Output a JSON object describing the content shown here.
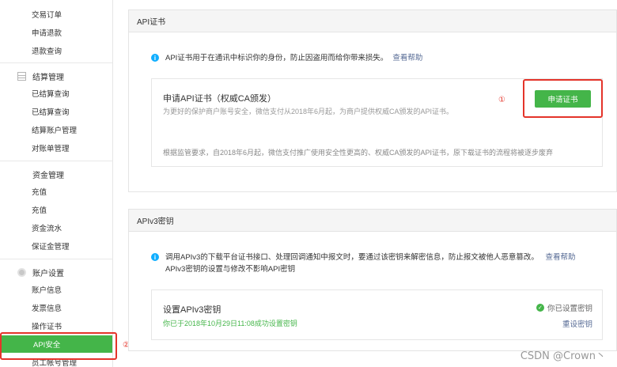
{
  "sidebar": {
    "trade_items": [
      "交易订单",
      "申请退款",
      "退款查询"
    ],
    "settlement": {
      "title": "结算管理",
      "items": [
        "已结算查询",
        "已结算查询",
        "结算账户管理",
        "对账单管理"
      ]
    },
    "funds": {
      "title": "资金管理",
      "items": [
        "充值",
        "充值",
        "资金流水",
        "保证金管理"
      ]
    },
    "account": {
      "title": "账户设置",
      "items": [
        "账户信息",
        "发票信息",
        "操作证书",
        "API安全",
        "员工帐号管理"
      ]
    }
  },
  "api_cert": {
    "header": "API证书",
    "info": "API证书用于在通讯中标识你的身份，防止因盗用而给你带来损失。",
    "help_link": "查看帮助",
    "title": "申请API证书（权威CA颁发）",
    "desc": "为更好的保护商户账号安全，微信支付从2018年6月起，为商户提供权威CA颁发的API证书。",
    "apply_button": "申请证书",
    "notice": "根据监管要求，自2018年6月起，微信支付推广使用安全性更高的、权威CA颁发的API证书，原下载证书的流程将被逐步废弃"
  },
  "apiv3": {
    "header": "APIv3密钥",
    "info_line1": "调用APIv3的下载平台证书接口、处理回调通知中报文时，要通过该密钥来解密信息，防止报文被他人恶意篡改。",
    "help_link": "查看帮助",
    "info_line2": "APIv3密钥的设置与修改不影响API密钥",
    "title": "设置APIv3密钥",
    "set_info": "你已于2018年10月29日11:08成功设置密钥",
    "status": "你已设置密钥",
    "reset_link": "重设密钥"
  },
  "annotations": {
    "mark1": "①",
    "mark2": "②"
  },
  "watermark": "CSDN @Crown丶",
  "colors": {
    "accent": "#44b549",
    "annotation": "#e4342a",
    "info": "#10aeff",
    "link": "#576b95"
  }
}
